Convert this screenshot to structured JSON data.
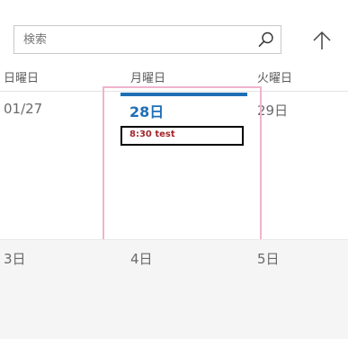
{
  "search": {
    "placeholder": "検索"
  },
  "icons": {
    "search": "search-icon",
    "up_arrow": "up-arrow-icon"
  },
  "header": {
    "days": [
      "日曜日",
      "月曜日",
      "火曜日"
    ]
  },
  "week1": {
    "days": [
      "01/27",
      "28日",
      "29日"
    ],
    "today_index": 1
  },
  "week2": {
    "days": [
      "3日",
      "4日",
      "5日"
    ]
  },
  "event": {
    "label": "8:30 test"
  },
  "colors": {
    "accent": "#1f6fb5",
    "event_text": "#a4262c",
    "selection": "#f0b3cd"
  }
}
